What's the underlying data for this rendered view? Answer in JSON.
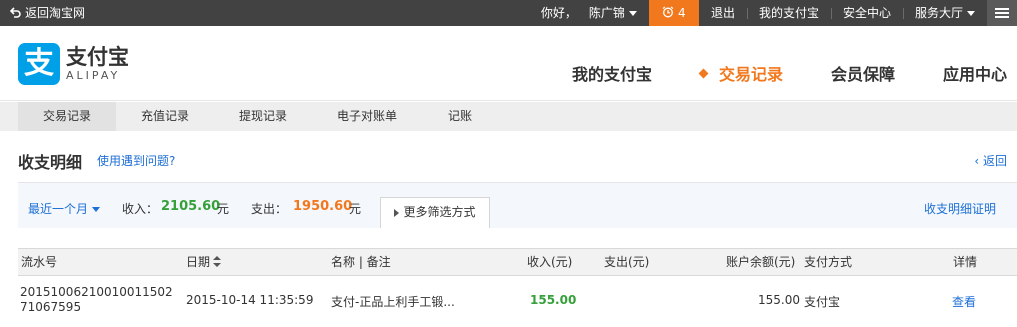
{
  "topbar": {
    "back_label": "返回淘宝网",
    "greeting": "你好，",
    "username": "陈广锦",
    "clock_count": "4",
    "logout": "退出",
    "my_alipay": "我的支付宝",
    "security": "安全中心",
    "service_hall": "服务大厅"
  },
  "header": {
    "logo_cn": "支付宝",
    "logo_en": "ALIPAY",
    "logo_mark": "支",
    "nav": [
      "我的支付宝",
      "交易记录",
      "会员保障",
      "应用中心"
    ],
    "active_nav": "交易记录"
  },
  "subnav": {
    "tabs": [
      "交易记录",
      "充值记录",
      "提现记录",
      "电子对账单",
      "记账"
    ],
    "active": "交易记录"
  },
  "page": {
    "title": "收支明细",
    "help_link": "使用遇到问题?",
    "back_link": "返回"
  },
  "filter": {
    "range": "最近一个月",
    "income_label": "收入：",
    "income_amount": "2105.60",
    "income_unit": "元",
    "expense_label": "支出：",
    "expense_amount": "1950.60",
    "expense_unit": "元",
    "more_filters": "更多筛选方式",
    "proof_link": "收支明细证明"
  },
  "table": {
    "headers": {
      "serial": "流水号",
      "date": "日期",
      "name": "名称 | 备注",
      "income": "收入(元)",
      "expense": "支出(元)",
      "balance": "账户余额(元)",
      "method": "支付方式",
      "detail": "详情"
    },
    "rows": [
      {
        "serial": "2015100621001001150271067595",
        "date": "2015-10-14 11:35:59",
        "name": "支付-正品上利手工锻...",
        "income": "155.00",
        "expense": "",
        "balance": "155.00",
        "method": "支付宝",
        "detail": "查看"
      }
    ]
  },
  "colors": {
    "topbar_bg": "#424242",
    "accent_orange": "#f2781e",
    "income_green": "#36a03a",
    "link_blue": "#1e6fd6",
    "logo_blue": "#00a0e9"
  }
}
